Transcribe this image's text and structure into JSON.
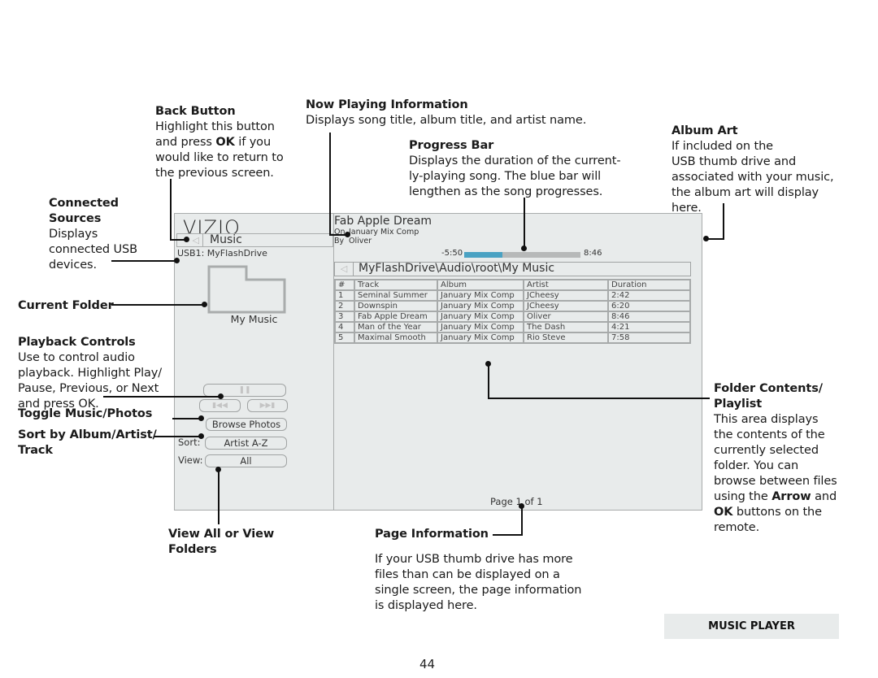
{
  "callouts": {
    "back_button": {
      "title": "Back Button",
      "lines": [
        "Highlight this button",
        "and press ",
        "OK",
        " if you",
        "would like to return to",
        "the previous screen."
      ]
    },
    "now_playing": {
      "title": "Now Playing Information",
      "text": "Displays song title, album title, and artist name."
    },
    "progress_bar": {
      "title": "Progress Bar",
      "lines": [
        "Displays the duration of the current-",
        "ly-playing song. The blue bar will",
        "lengthen as the song progresses."
      ]
    },
    "album_art": {
      "title": "Album Art",
      "lines": [
        "If included on the",
        "USB thumb drive and",
        "associated with your music,",
        "the album art will display",
        "here."
      ]
    },
    "connected_sources": {
      "title_lines": [
        "Connected",
        "Sources"
      ],
      "lines": [
        "Displays",
        "connected USB",
        "devices."
      ]
    },
    "current_folder": {
      "title": "Current Folder"
    },
    "playback_controls": {
      "title": "Playback Controls",
      "lines": [
        "Use to control audio",
        "playback. Highlight Play/",
        "Pause, Previous, or Next",
        "and press OK."
      ]
    },
    "toggle_music_photos": {
      "title": "Toggle Music/Photos"
    },
    "sort": {
      "title_lines": [
        "Sort by Album/Artist/",
        "Track"
      ]
    },
    "view_all": {
      "title_lines": [
        "View All or View",
        "Folders"
      ]
    },
    "page_information": {
      "title": "Page Information",
      "lines": [
        "If your USB thumb drive has more",
        "files than can be displayed on a",
        "single screen, the page information",
        "is displayed here."
      ]
    },
    "folder_contents": {
      "title_lines": [
        "Folder Contents/",
        "Playlist"
      ],
      "lines": [
        "This area displays",
        "the contents of the",
        "currently selected",
        "folder. You can",
        "browse between files",
        "using the ",
        "Arrow",
        " and",
        "OK",
        " buttons on the",
        "remote."
      ]
    }
  },
  "tv_ui": {
    "logo": "VIZIO",
    "back_icon": "back-arrow-icon",
    "section_label": "Music",
    "source": "USB1: MyFlashDrive",
    "folder_name": "My Music",
    "controls": {
      "play_pause": "❚❚",
      "previous": "▮◀◀",
      "next": "▶▶▮"
    },
    "browse_photos_label": "Browse Photos",
    "sort_label": "Sort:",
    "sort_value": "Artist A-Z",
    "view_label": "View:",
    "view_value": "All",
    "now_playing": {
      "title": "Fab Apple Dream",
      "on_label": "On",
      "album": "January Mix Comp",
      "by_label": "By",
      "artist": "Oliver"
    },
    "progress": {
      "remaining": "-5:50",
      "total": "8:46",
      "fraction": 0.33,
      "fill_color": "#4aa2c3",
      "track_color": "#b7b9b9"
    },
    "path": "MyFlashDrive\\Audio\\root\\My Music",
    "playlist": {
      "columns": [
        "#",
        "Track",
        "Album",
        "Artist",
        "Duration"
      ],
      "rows": [
        [
          "1",
          "Seminal Summer",
          "January Mix Comp",
          "JCheesy",
          "2:42"
        ],
        [
          "2",
          "Downspin",
          "January Mix Comp",
          "JCheesy",
          "6:20"
        ],
        [
          "3",
          "Fab Apple Dream",
          "January Mix Comp",
          "Oliver",
          "8:46"
        ],
        [
          "4",
          "Man of the Year",
          "January Mix Comp",
          "The Dash",
          "4:21"
        ],
        [
          "5",
          "Maximal Smooth",
          "January Mix Comp",
          "Rio Steve",
          "7:58"
        ]
      ]
    },
    "page_info": "Page 1 of 1"
  },
  "footer": {
    "section": "MUSIC PLAYER",
    "page_number": "44"
  }
}
